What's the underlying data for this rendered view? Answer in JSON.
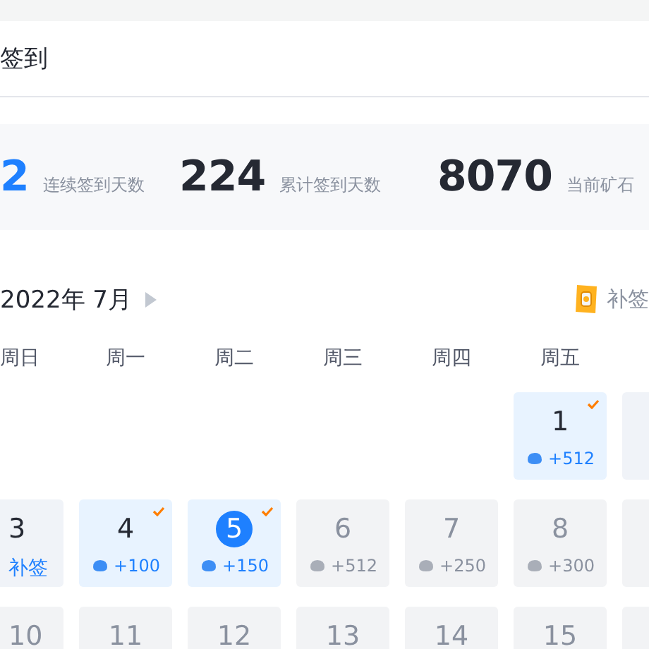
{
  "header": {
    "title": "签到"
  },
  "stats": [
    {
      "value": "2",
      "label": "连续签到天数",
      "highlight": true
    },
    {
      "value": "224",
      "label": "累计签到天数",
      "highlight": false
    },
    {
      "value": "8070",
      "label": "当前矿石",
      "highlight": false
    }
  ],
  "month": {
    "title": "2022年 7月",
    "makeup_card": "补签"
  },
  "weekdays": [
    "周日",
    "周一",
    "周二",
    "周三",
    "周四",
    "周五"
  ],
  "weeks": [
    [
      {
        "kind": "empty"
      },
      {
        "kind": "empty"
      },
      {
        "kind": "empty"
      },
      {
        "kind": "empty"
      },
      {
        "kind": "empty"
      },
      {
        "kind": "signed",
        "day": "1",
        "reward": "+512",
        "checked": true,
        "today": false
      },
      {
        "kind": "missed"
      }
    ],
    [
      {
        "kind": "missed",
        "day": "3",
        "reward": "补签"
      },
      {
        "kind": "signed",
        "day": "4",
        "reward": "+100",
        "checked": true,
        "today": false
      },
      {
        "kind": "signed",
        "day": "5",
        "reward": "+150",
        "checked": true,
        "today": true
      },
      {
        "kind": "future",
        "day": "6",
        "reward": "+512"
      },
      {
        "kind": "future",
        "day": "7",
        "reward": "+250"
      },
      {
        "kind": "future",
        "day": "8",
        "reward": "+300"
      },
      {
        "kind": "future"
      }
    ],
    [
      {
        "kind": "future",
        "day": "10"
      },
      {
        "kind": "future",
        "day": "11"
      },
      {
        "kind": "future",
        "day": "12"
      },
      {
        "kind": "future",
        "day": "13"
      },
      {
        "kind": "future",
        "day": "14"
      },
      {
        "kind": "future",
        "day": "15"
      },
      {
        "kind": "future"
      }
    ]
  ]
}
